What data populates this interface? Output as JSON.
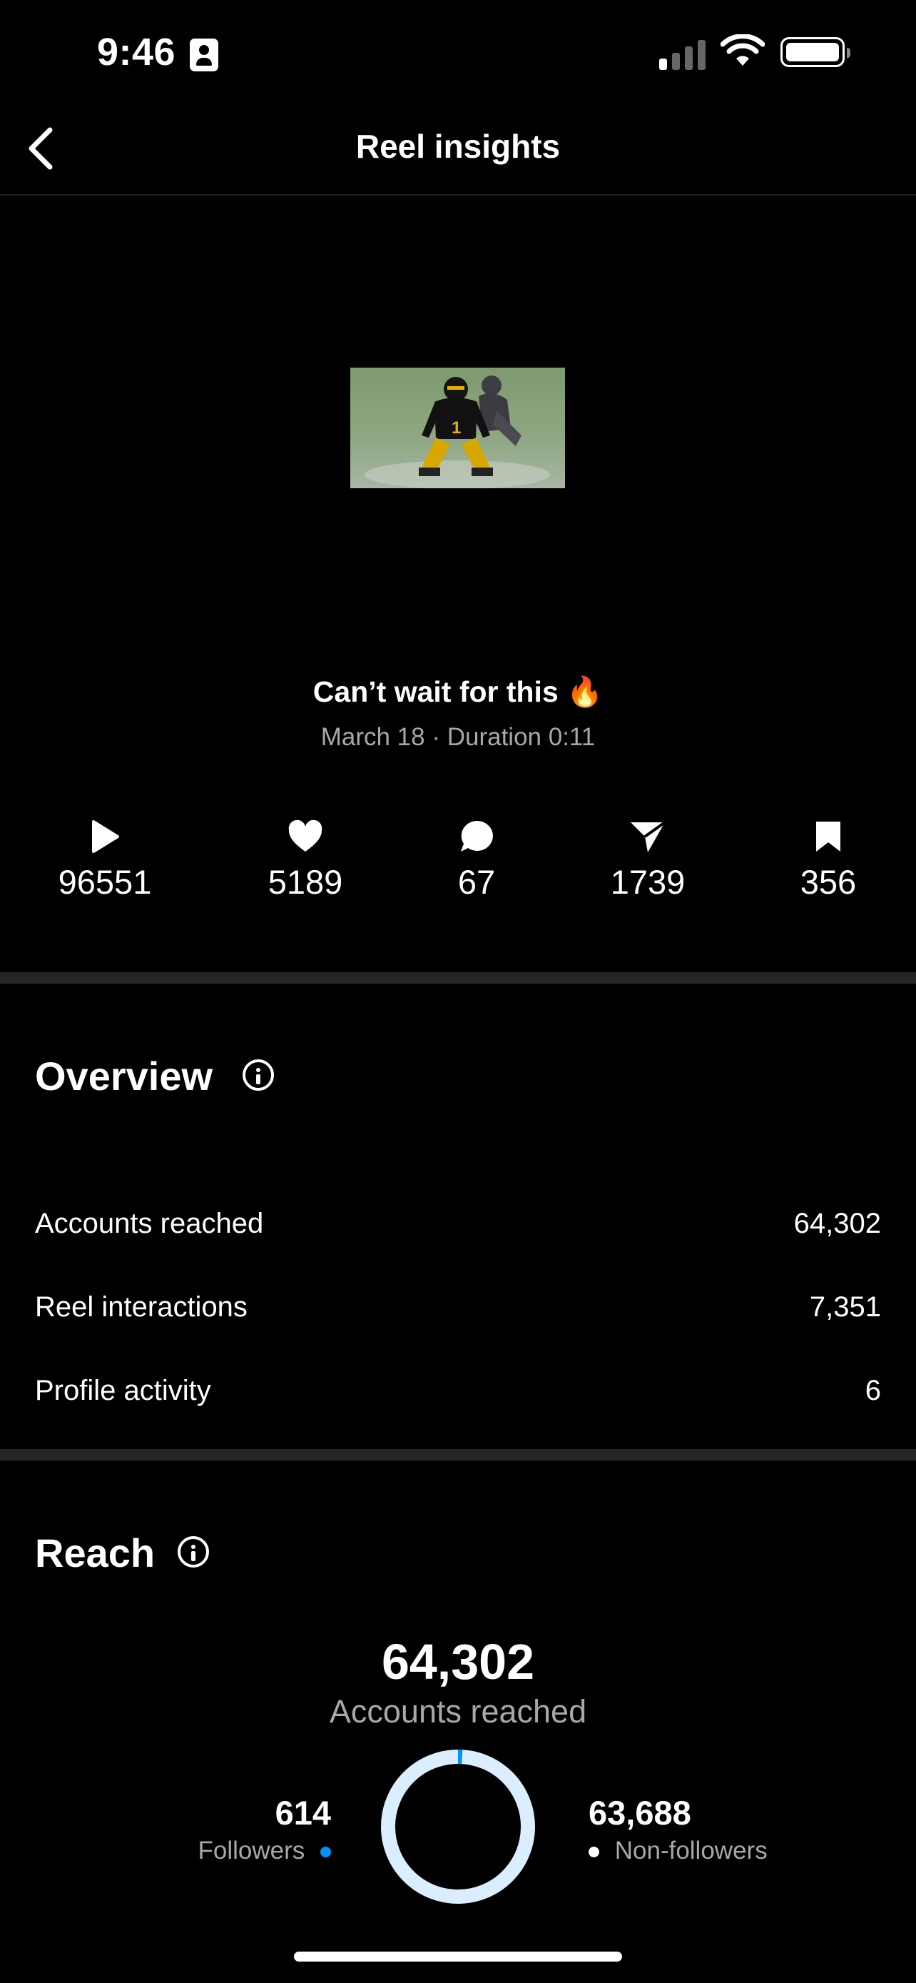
{
  "status_bar": {
    "time": "9:46"
  },
  "header": {
    "title": "Reel insights",
    "back_icon": "chevron-left-icon"
  },
  "reel": {
    "caption": "Can’t wait for this 🔥",
    "meta": "March 18 · Duration 0:11"
  },
  "metrics": [
    {
      "icon": "play-icon",
      "value": "96551"
    },
    {
      "icon": "heart-icon",
      "value": "5189"
    },
    {
      "icon": "comment-icon",
      "value": "67"
    },
    {
      "icon": "share-icon",
      "value": "1739"
    },
    {
      "icon": "bookmark-icon",
      "value": "356"
    }
  ],
  "overview": {
    "title": "Overview",
    "rows": [
      {
        "label": "Accounts reached",
        "value": "64,302"
      },
      {
        "label": "Reel interactions",
        "value": "7,351"
      },
      {
        "label": "Profile activity",
        "value": "6"
      }
    ]
  },
  "reach": {
    "title": "Reach",
    "total": "64,302",
    "total_label": "Accounts reached",
    "followers": {
      "value": "614",
      "label": "Followers",
      "color": "#0095f6",
      "share": 0.0095
    },
    "non_followers": {
      "value": "63,688",
      "label": "Non-followers",
      "color": "#dbeeff",
      "share": 0.9905
    }
  },
  "colors": {
    "background": "#000000",
    "divider": "#262626",
    "muted_text": "#a8a8a8"
  }
}
